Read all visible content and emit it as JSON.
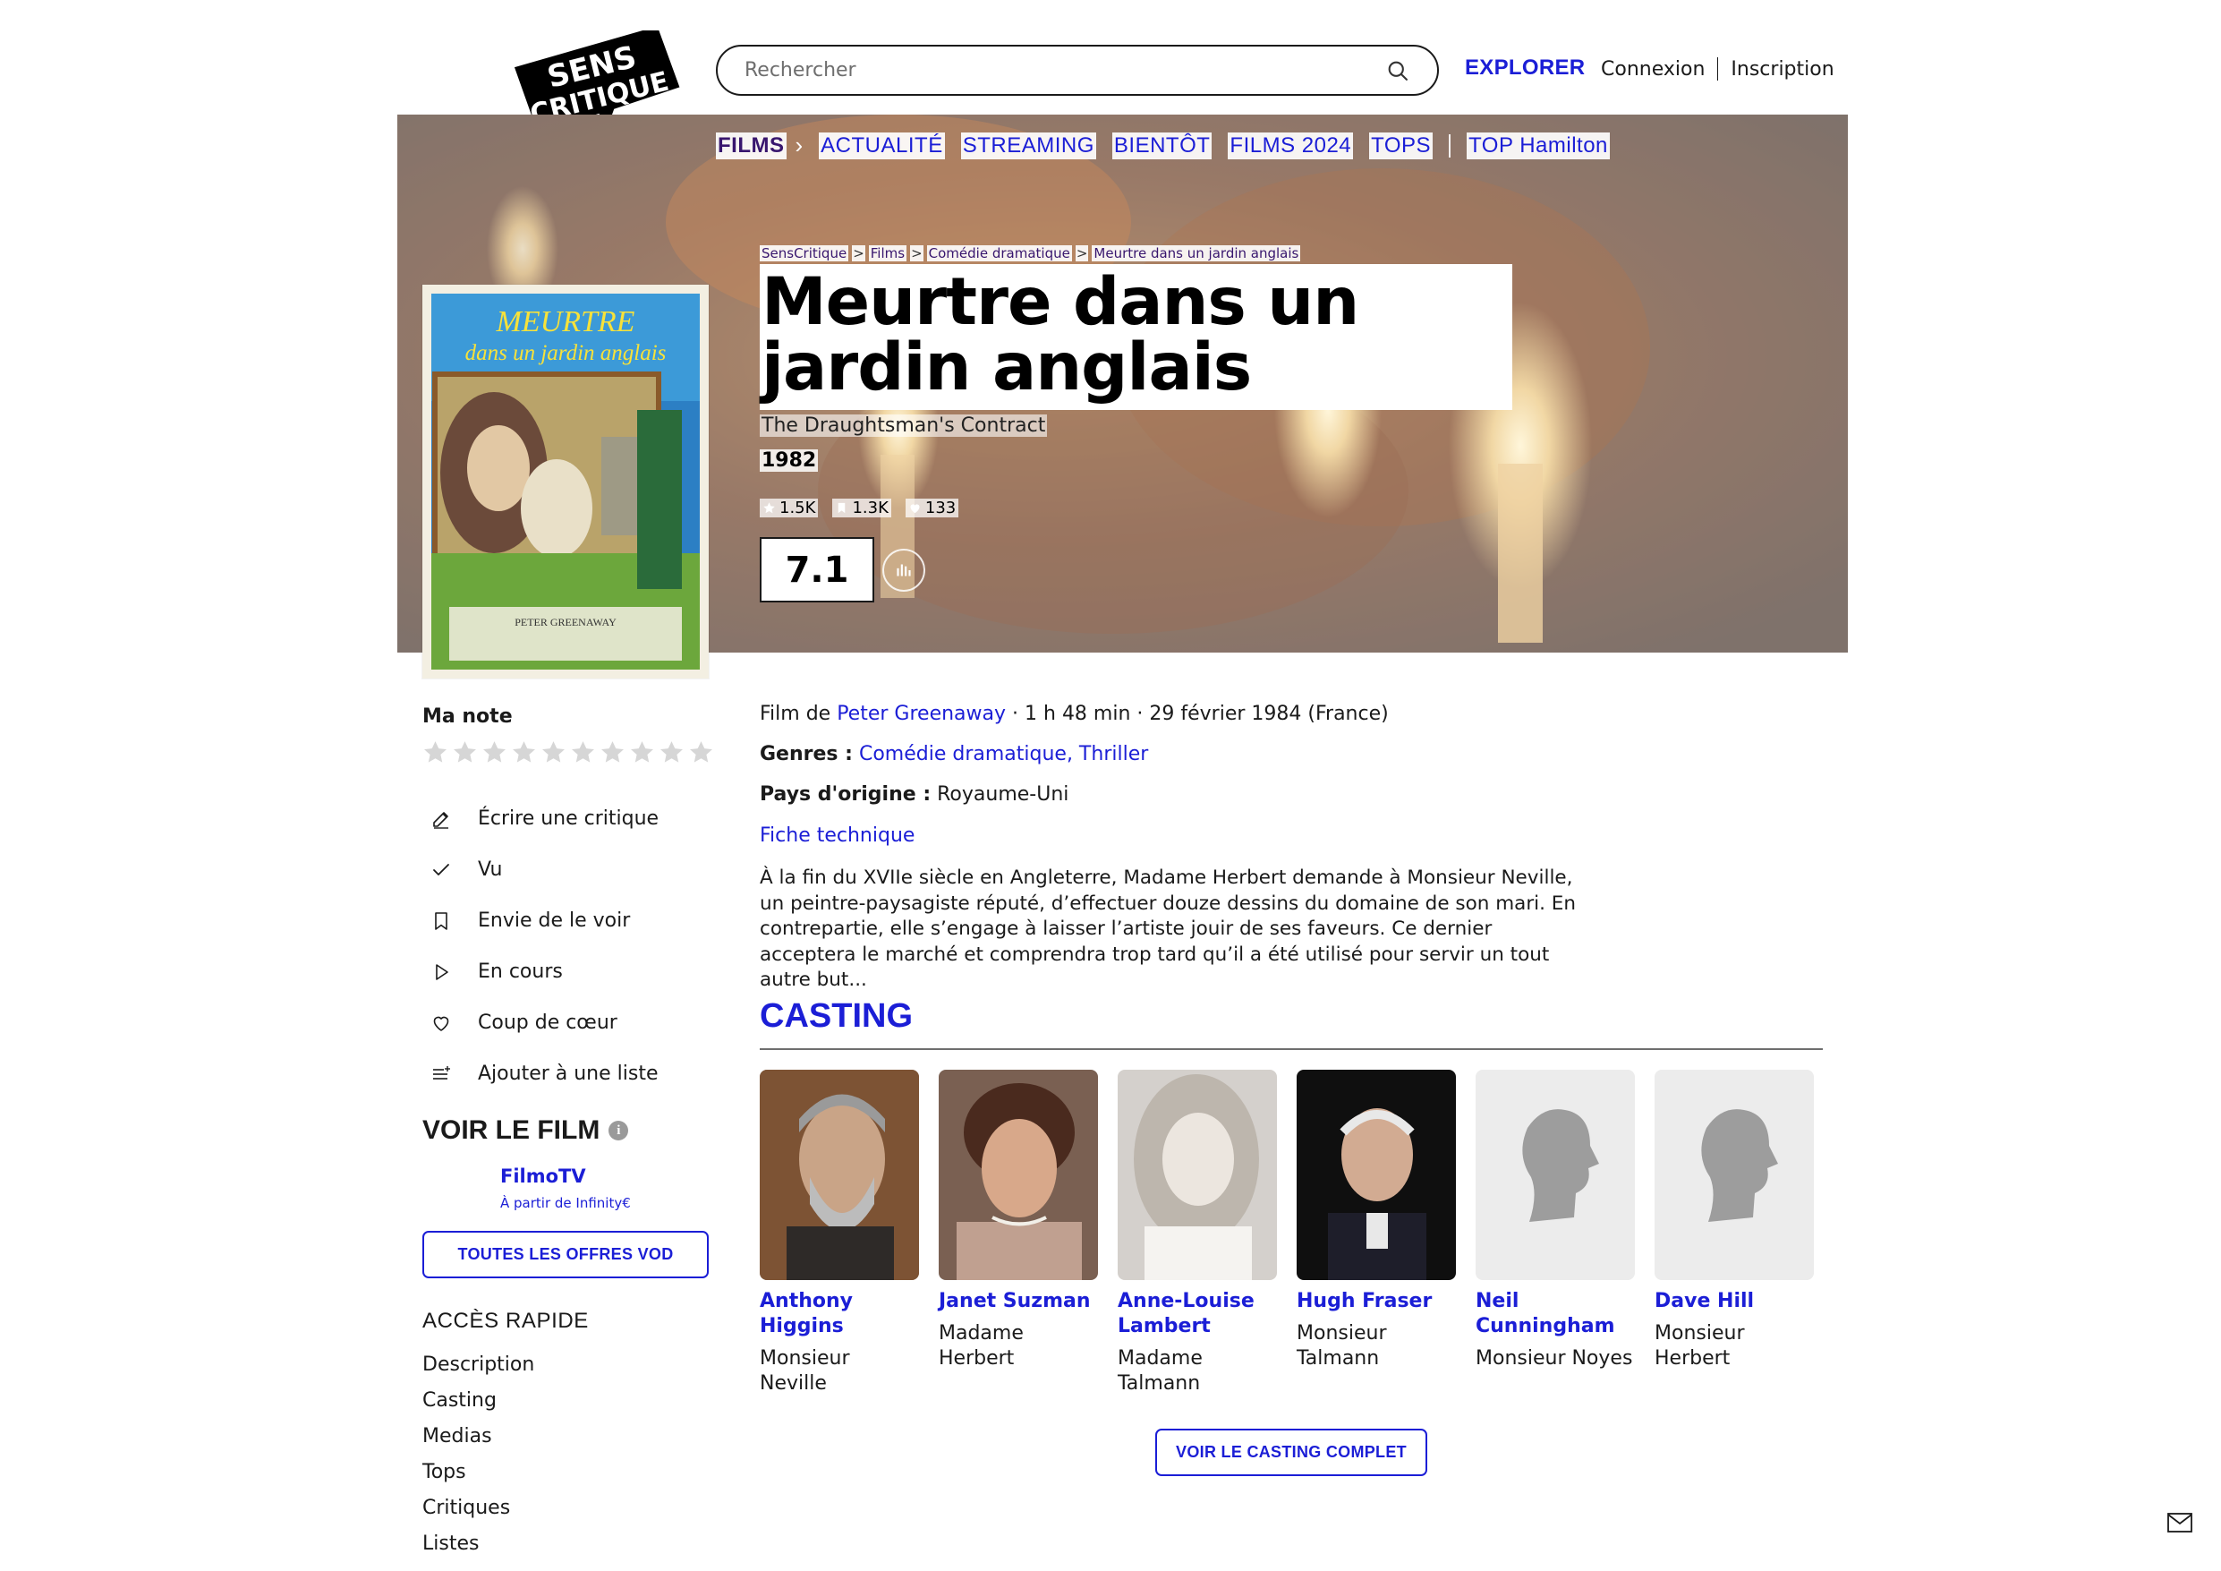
{
  "header": {
    "logo_line1": "SENS",
    "logo_line2": "CRITIQUE",
    "search_placeholder": "Rechercher",
    "explorer": "EXPLORER",
    "login": "Connexion",
    "signup": "Inscription"
  },
  "nav": {
    "films": "FILMS",
    "items": [
      "ACTUALITÉ",
      "STREAMING",
      "BIENTÔT",
      "FILMS 2024",
      "TOPS"
    ],
    "top": "TOP Hamilton"
  },
  "breadcrumb": [
    "SensCritique",
    "Films",
    "Comédie dramatique",
    "Meurtre dans un jardin anglais"
  ],
  "movie": {
    "title": "Meurtre dans un jardin anglais",
    "original_title": "The Draughtsman's Contract",
    "year": "1982",
    "ratings_count": "1.5K",
    "wishlist_count": "1.3K",
    "favorites_count": "133",
    "score": "7.1",
    "poster_text_1": "MEURTRE",
    "poster_text_2": "dans un jardin anglais",
    "poster_director": "PETER GREENAWAY"
  },
  "sidebar": {
    "my_rating": "Ma note",
    "actions": [
      "Écrire une critique",
      "Vu",
      "Envie de le voir",
      "En cours",
      "Coup de cœur",
      "Ajouter à une liste"
    ],
    "watch_title": "VOIR LE FILM",
    "vod_provider": "FilmoTV",
    "vod_price": "À partir de Infinity€",
    "vod_all": "TOUTES LES OFFRES VOD",
    "quick_access": "ACCÈS RAPIDE",
    "quick_links": [
      "Description",
      "Casting",
      "Medias",
      "Tops",
      "Critiques",
      "Listes"
    ]
  },
  "info": {
    "film_by": "Film de",
    "director": "Peter Greenaway",
    "details": " · 1 h 48 min · 29 février 1984 (France)",
    "genres_label": "Genres :",
    "genres": "Comédie dramatique, Thriller",
    "country_label": "Pays d'origine :",
    "country": "Royaume-Uni",
    "tech_sheet": "Fiche technique",
    "synopsis": "À la fin du XVIIe siècle en Angleterre, Madame Herbert demande à Monsieur Neville, un peintre-paysagiste réputé, d’effectuer douze dessins du domaine de son mari. En contrepartie, elle s’engage à laisser l’artiste jouir de ses faveurs. Ce dernier acceptera le marché et comprendra trop tard qu’il a été utilisé pour servir un tout autre but..."
  },
  "casting": {
    "title": "CASTING",
    "members": [
      {
        "name": "Anthony Higgins",
        "role": "Monsieur Neville"
      },
      {
        "name": "Janet Suzman",
        "role": "Madame Herbert"
      },
      {
        "name": "Anne-Louise Lambert",
        "role": "Madame Talmann"
      },
      {
        "name": "Hugh Fraser",
        "role": "Monsieur Talmann"
      },
      {
        "name": "Neil Cunningham",
        "role": "Monsieur Noyes"
      },
      {
        "name": "Dave Hill",
        "role": "Monsieur Herbert"
      }
    ],
    "see_all": "VOIR LE CASTING COMPLET"
  },
  "colors": {
    "accent": "#1b1ed6",
    "nav_active": "#38166e",
    "text": "#1a1a1a"
  },
  "icons": [
    "search-icon",
    "chevron-right-icon",
    "star-icon",
    "bookmark-icon",
    "heart-icon",
    "chart-icon",
    "pencil-icon",
    "check-icon",
    "play-icon",
    "list-add-icon",
    "info-icon",
    "mail-icon"
  ]
}
